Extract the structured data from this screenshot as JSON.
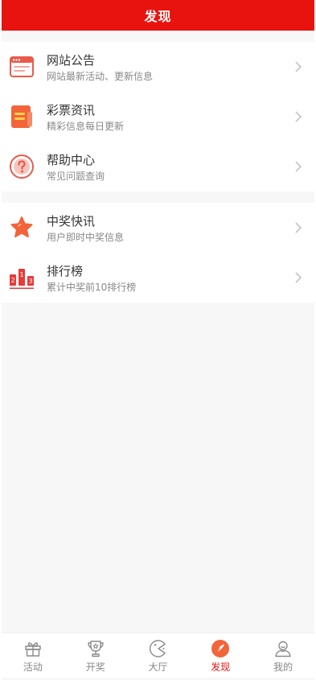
{
  "header": {
    "title": "发现"
  },
  "groups": [
    {
      "items": [
        {
          "title": "网站公告",
          "subtitle": "网站最新活动、更新信息",
          "icon": "announcement-icon"
        },
        {
          "title": "彩票资讯",
          "subtitle": "精彩信息每日更新",
          "icon": "news-icon"
        },
        {
          "title": "帮助中心",
          "subtitle": "常见问题查询",
          "icon": "help-icon"
        }
      ]
    },
    {
      "items": [
        {
          "title": "中奖快讯",
          "subtitle": "用户即时中奖信息",
          "icon": "star-icon"
        },
        {
          "title": "排行榜",
          "subtitle": "累计中奖前10排行榜",
          "icon": "podium-icon"
        }
      ]
    }
  ],
  "tabbar": {
    "items": [
      {
        "label": "活动",
        "icon": "gift-icon",
        "active": false
      },
      {
        "label": "开奖",
        "icon": "trophy-icon",
        "active": false
      },
      {
        "label": "大厅",
        "icon": "pacman-icon",
        "active": false
      },
      {
        "label": "发现",
        "icon": "compass-icon",
        "active": true
      },
      {
        "label": "我的",
        "icon": "user-icon",
        "active": false
      }
    ]
  },
  "colors": {
    "accent": "#e8130e",
    "icon_red": "#e95a4a",
    "icon_orange": "#f2643a",
    "text": "#333333",
    "muted": "#888888"
  }
}
